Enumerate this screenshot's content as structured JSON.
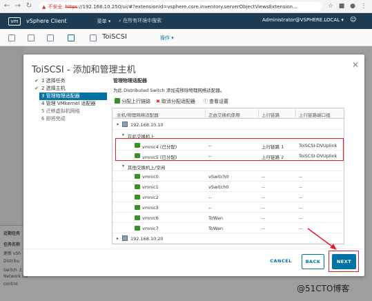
{
  "browser": {
    "warning": "不安全",
    "https": "https",
    "url_rest": "://192.168.10.250/ui/#?extensionId=vsphere.core.inventory.serverObjectViewsExtension..."
  },
  "app": {
    "logo": "vm",
    "title": "vSphere Client",
    "menu": "菜单 ▾",
    "search_placeholder": "在所有环境中搜索",
    "user": "Administrator@VSPHERE.LOCAL ▾"
  },
  "object": {
    "title": "ToiSCSI",
    "actions": "操作 ▾"
  },
  "background_panel": {
    "recent_tasks": "近期任务",
    "task_name": "任务名称",
    "rows": [
      "更新 vSh",
      "Distribu",
      "Switch 上",
      "Network I/O",
      "control"
    ]
  },
  "modal": {
    "title": "ToiSCSI - 添加和管理主机",
    "close": "✕",
    "steps": [
      {
        "label": "1 选择任务",
        "state": "done"
      },
      {
        "label": "2 选择主机",
        "state": "done"
      },
      {
        "label": "3 管理物理适配器",
        "state": "active"
      },
      {
        "label": "4 管理 VMkernel 适配器",
        "state": "todo"
      },
      {
        "label": "5 迁移虚拟机网络",
        "state": "todo"
      },
      {
        "label": "6 即将完成",
        "state": "todo"
      }
    ],
    "heading": "管理物理适配器",
    "description": "为此 Distributed Switch 添加或移除物理网络适配器。",
    "toolbar": {
      "assign": "分配上行链路",
      "unassign": "取消分配适配器",
      "view": "查看设置"
    },
    "columns": [
      "主机/物理网络适配器",
      "正由交换机使用",
      "上行链路",
      "上行链路端口组"
    ],
    "rows": [
      {
        "type": "host",
        "name": "192.168.10.10"
      },
      {
        "type": "group",
        "name": "在此交换机上"
      },
      {
        "type": "nic",
        "name": "vmnic4 (已分配)",
        "switch": "--",
        "uplink": "上行链路 1",
        "portgroup": "ToiSCSI-DVUplink"
      },
      {
        "type": "nic",
        "name": "vmnic5 (已分配)",
        "switch": "--",
        "uplink": "上行链路 2",
        "portgroup": "ToiSCSI-DVUplink"
      },
      {
        "type": "group",
        "name": "其他交换机上/空闲"
      },
      {
        "type": "nic",
        "name": "vmnic0",
        "switch": "vSwitch0",
        "uplink": "--",
        "portgroup": "--"
      },
      {
        "type": "nic",
        "name": "vmnic1",
        "switch": "vSwitch0",
        "uplink": "--",
        "portgroup": "--"
      },
      {
        "type": "nic",
        "name": "vmnic2",
        "switch": "--",
        "uplink": "--",
        "portgroup": "--"
      },
      {
        "type": "nic",
        "name": "vmnic3",
        "switch": "--",
        "uplink": "--",
        "portgroup": "--"
      },
      {
        "type": "nic",
        "name": "vmnic6",
        "switch": "ToWan",
        "uplink": "--",
        "portgroup": "--"
      },
      {
        "type": "nic",
        "name": "vmnic7",
        "switch": "ToWan",
        "uplink": "--",
        "portgroup": "--"
      },
      {
        "type": "host",
        "name": "192.168.10.20"
      }
    ],
    "buttons": {
      "cancel": "CANCEL",
      "back": "BACK",
      "next": "NEXT"
    }
  },
  "watermark": "@51CTO博客",
  "colors": {
    "accent": "#0072a3",
    "header": "#1d3b53",
    "highlight": "#e0202c",
    "check": "#3a8f2a"
  }
}
